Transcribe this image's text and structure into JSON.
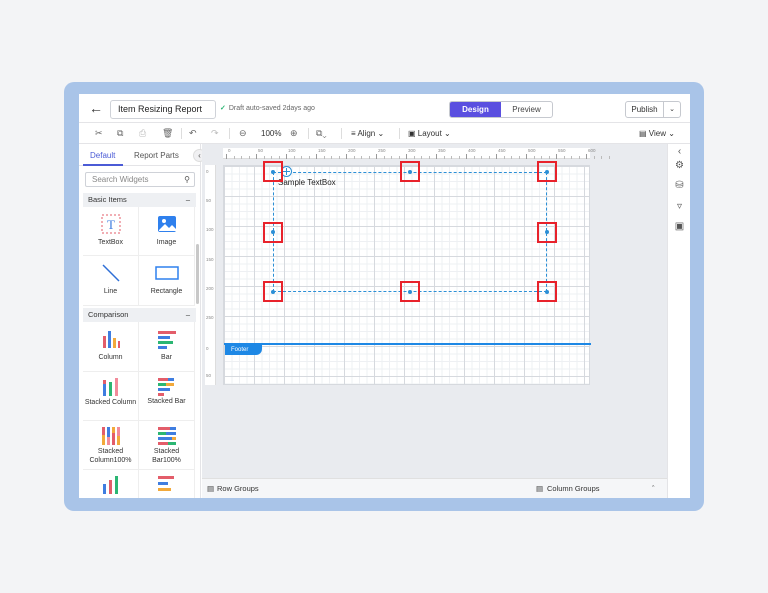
{
  "header": {
    "report_title": "Item Resizing Report",
    "autosave_text": "Draft auto-saved 2days ago",
    "design_label": "Design",
    "preview_label": "Preview",
    "publish_label": "Publish"
  },
  "toolbar": {
    "zoom": "100%",
    "align_label": "Align",
    "layout_label": "Layout",
    "view_label": "View"
  },
  "left_panel": {
    "tab_default": "Default",
    "tab_report_parts": "Report Parts",
    "search_placeholder": "Search Widgets",
    "section_basic": "Basic Items",
    "section_comparison": "Comparison",
    "basic_items": [
      "TextBox",
      "Image",
      "Line",
      "Rectangle"
    ],
    "comparison_items": [
      "Column",
      "Bar",
      "Stacked Column",
      "Stacked Bar",
      "Stacked Column100%",
      "Stacked Bar100%"
    ]
  },
  "canvas": {
    "sample_text": "Sample TextBox",
    "footer_label": "Footer",
    "ruler_top": [
      "0",
      "50",
      "100",
      "150",
      "200",
      "250",
      "300",
      "350",
      "400",
      "450",
      "500",
      "550",
      "600"
    ],
    "ruler_left": [
      "0",
      "50",
      "100",
      "150",
      "200",
      "250",
      "0",
      "50"
    ]
  },
  "bottom": {
    "row_groups": "Row Groups",
    "column_groups": "Column Groups"
  },
  "colors": {
    "accent": "#5a4fe0",
    "selection": "#2b8fd6",
    "highlight": "#e8222b",
    "footer": "#1e88e5"
  }
}
